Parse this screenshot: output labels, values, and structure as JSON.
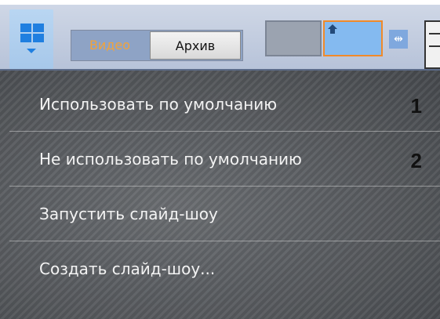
{
  "toolbar": {
    "layout_icon": "layout-grid-icon",
    "mode_video_label": "Видео",
    "mode_archive_label": "Архив",
    "accent_color": "#f08a2a",
    "split_icon": "split-arrows-icon",
    "panel_icon": "panel-menu-icon"
  },
  "menu": {
    "items": [
      {
        "label": "Использовать по умолчанию",
        "number": "1"
      },
      {
        "label": "Не использовать по умолчанию",
        "number": "2"
      },
      {
        "label": "Запустить слайд-шоу",
        "number": ""
      },
      {
        "label": "Создать слайд-шоу...",
        "number": ""
      }
    ]
  }
}
